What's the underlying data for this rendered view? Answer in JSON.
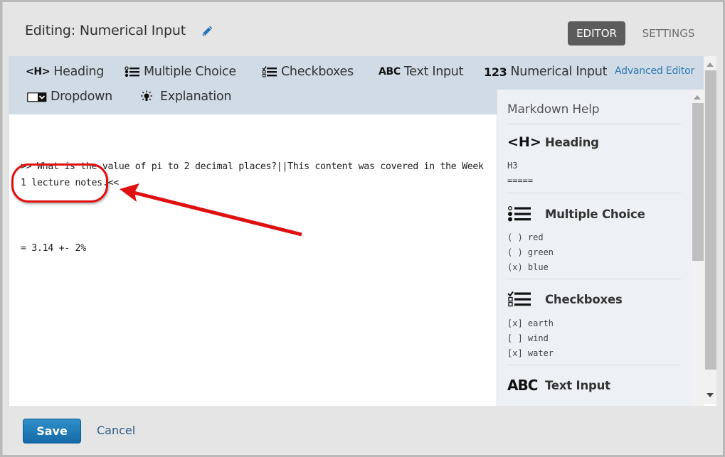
{
  "header": {
    "title": "Editing: Numerical Input",
    "tabs": [
      {
        "label": "EDITOR",
        "active": true
      },
      {
        "label": "SETTINGS",
        "active": false
      }
    ]
  },
  "toolbar": {
    "items": [
      {
        "label": "Heading",
        "icon": "heading-icon"
      },
      {
        "label": "Multiple Choice",
        "icon": "multiple-choice-icon"
      },
      {
        "label": "Checkboxes",
        "icon": "checkboxes-icon"
      },
      {
        "label": "Text Input",
        "icon": "text-input-icon"
      },
      {
        "label": "Numerical Input",
        "icon": "numerical-input-icon"
      },
      {
        "label": "Dropdown",
        "icon": "dropdown-icon"
      },
      {
        "label": "Explanation",
        "icon": "lightbulb-icon"
      }
    ],
    "advanced_editor": "Advanced Editor",
    "icon_text": {
      "heading": "<H>",
      "text_input": "ABC",
      "numerical": "123"
    }
  },
  "editor": {
    "question_line": ">> What is the value of pi to 2 decimal places?||This content was covered in the Week 1 lecture notes.<<",
    "answer_line": "= 3.14 +- 2%"
  },
  "annotation": {
    "color": "#e01010"
  },
  "help": {
    "title": "Markdown Help",
    "sections": [
      {
        "label": "Heading",
        "icon_text": "<H>",
        "code": "H3\n====="
      },
      {
        "label": "Multiple Choice",
        "code": "( ) red\n( ) green\n(x) blue"
      },
      {
        "label": "Checkboxes",
        "code": "[x] earth\n[ ] wind\n[x] water"
      },
      {
        "label": "Text Input",
        "icon_text": "ABC"
      }
    ]
  },
  "footer": {
    "save": "Save",
    "cancel": "Cancel"
  },
  "colors": {
    "accent": "#2d7ab4",
    "toolbar_bg": "#d0dbe5",
    "active_tab_bg": "#5c5c5c",
    "save_bg": "#1f7dbd"
  }
}
